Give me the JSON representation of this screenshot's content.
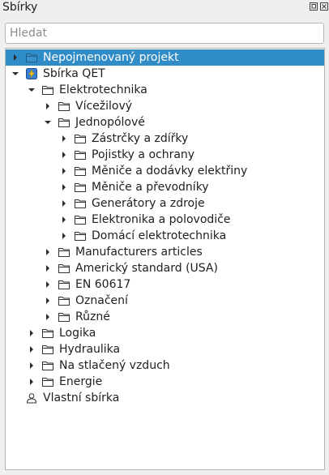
{
  "panel": {
    "title": "Sbírky"
  },
  "search": {
    "placeholder": "Hledat"
  },
  "tree": {
    "items": [
      {
        "label": "Nepojmenovaný projekt",
        "depth": 0,
        "arrow": "right",
        "icon": "project",
        "selected": true
      },
      {
        "label": "Sbírka QET",
        "depth": 0,
        "arrow": "down",
        "icon": "qet",
        "selected": false
      },
      {
        "label": "Elektrotechnika",
        "depth": 1,
        "arrow": "down",
        "icon": "folder",
        "selected": false
      },
      {
        "label": "Vícežilový",
        "depth": 2,
        "arrow": "right",
        "icon": "folder",
        "selected": false
      },
      {
        "label": "Jednopólové",
        "depth": 2,
        "arrow": "down",
        "icon": "folder",
        "selected": false
      },
      {
        "label": "Zástrčky a zdířky",
        "depth": 3,
        "arrow": "right",
        "icon": "folder",
        "selected": false
      },
      {
        "label": "Pojistky a ochrany",
        "depth": 3,
        "arrow": "right",
        "icon": "folder",
        "selected": false
      },
      {
        "label": "Měniče a dodávky elektřiny",
        "depth": 3,
        "arrow": "right",
        "icon": "folder",
        "selected": false
      },
      {
        "label": "Měniče a převodníky",
        "depth": 3,
        "arrow": "right",
        "icon": "folder",
        "selected": false
      },
      {
        "label": "Generátory a zdroje",
        "depth": 3,
        "arrow": "right",
        "icon": "folder",
        "selected": false
      },
      {
        "label": "Elektronika a polovodiče",
        "depth": 3,
        "arrow": "right",
        "icon": "folder",
        "selected": false
      },
      {
        "label": "Domácí elektrotechnika",
        "depth": 3,
        "arrow": "right",
        "icon": "folder",
        "selected": false
      },
      {
        "label": "Manufacturers articles",
        "depth": 2,
        "arrow": "right",
        "icon": "folder",
        "selected": false
      },
      {
        "label": "Americký standard (USA)",
        "depth": 2,
        "arrow": "right",
        "icon": "folder",
        "selected": false
      },
      {
        "label": "EN 60617",
        "depth": 2,
        "arrow": "right",
        "icon": "folder",
        "selected": false
      },
      {
        "label": "Označení",
        "depth": 2,
        "arrow": "right",
        "icon": "folder",
        "selected": false
      },
      {
        "label": "Různé",
        "depth": 2,
        "arrow": "right",
        "icon": "folder",
        "selected": false
      },
      {
        "label": "Logika",
        "depth": 1,
        "arrow": "right",
        "icon": "folder",
        "selected": false
      },
      {
        "label": "Hydraulika",
        "depth": 1,
        "arrow": "right",
        "icon": "folder",
        "selected": false
      },
      {
        "label": "Na stlačený vzduch",
        "depth": 1,
        "arrow": "right",
        "icon": "folder",
        "selected": false
      },
      {
        "label": "Energie",
        "depth": 1,
        "arrow": "right",
        "icon": "folder",
        "selected": false
      },
      {
        "label": "Vlastní sbírka",
        "depth": 0,
        "arrow": "none",
        "icon": "user",
        "selected": false
      }
    ]
  },
  "colors": {
    "selection": "#308cc6",
    "background": "#efefef"
  }
}
